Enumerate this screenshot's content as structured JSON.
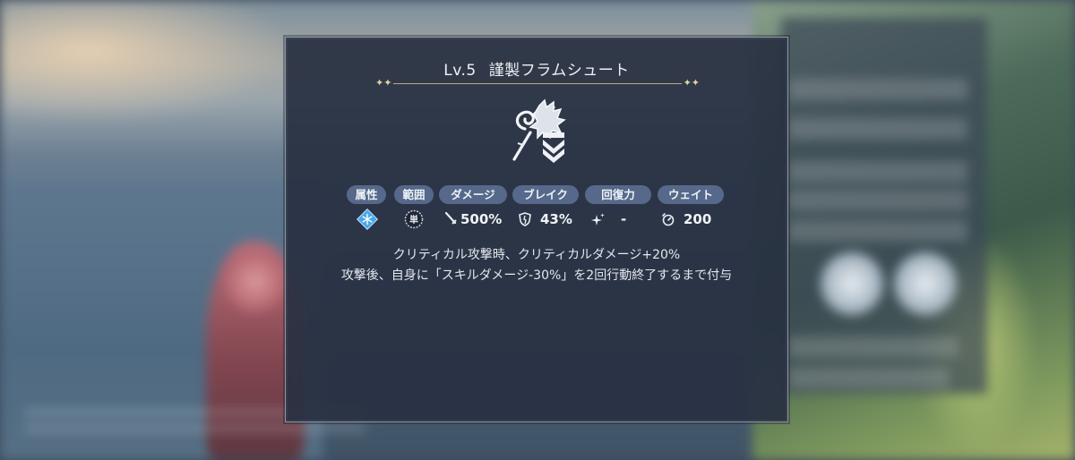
{
  "tooltip": {
    "level": "Lv.5",
    "skill_name": "謹製フラムシュート",
    "icon": "flame-shot-skill-icon",
    "stat_labels": [
      "属性",
      "範囲",
      "ダメージ",
      "ブレイク",
      "回復力",
      "ウェイト"
    ],
    "stats": {
      "attribute_icon": "ice-snowflake-icon",
      "range_icon": "single-target-icon",
      "range_glyph": "単",
      "damage": "500%",
      "break": "43%",
      "heal": "-",
      "wait": "200"
    },
    "description": [
      "クリティカル攻撃時、クリティカルダメージ+20%",
      "攻撃後、自身に「スキルダメージ-30%」を2回行動終了するまで付与"
    ]
  },
  "colors": {
    "panel_bg": "#283042",
    "tag_bg": "#56698a",
    "divider": "#b9a97c",
    "ice": "#4aa8e8"
  }
}
